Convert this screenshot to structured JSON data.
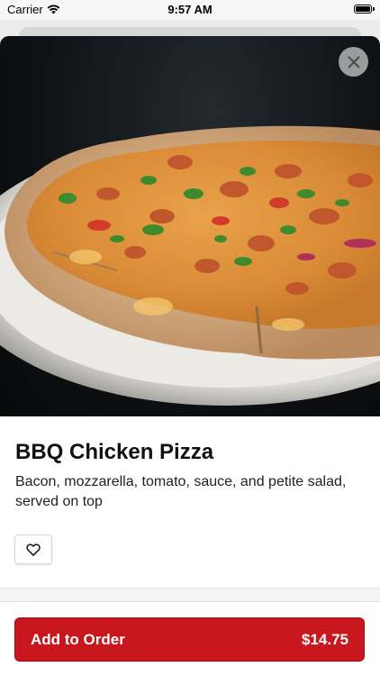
{
  "status_bar": {
    "carrier": "Carrier",
    "time": "9:57 AM"
  },
  "item": {
    "name": "BBQ Chicken Pizza",
    "description": "Bacon, mozzarella, tomato, sauce, and petite salad, served on top",
    "image_description_icon": "pizza-photo"
  },
  "actions": {
    "add_label": "Add to Order",
    "price": "$14.75"
  },
  "colors": {
    "accent": "#c8171e"
  }
}
